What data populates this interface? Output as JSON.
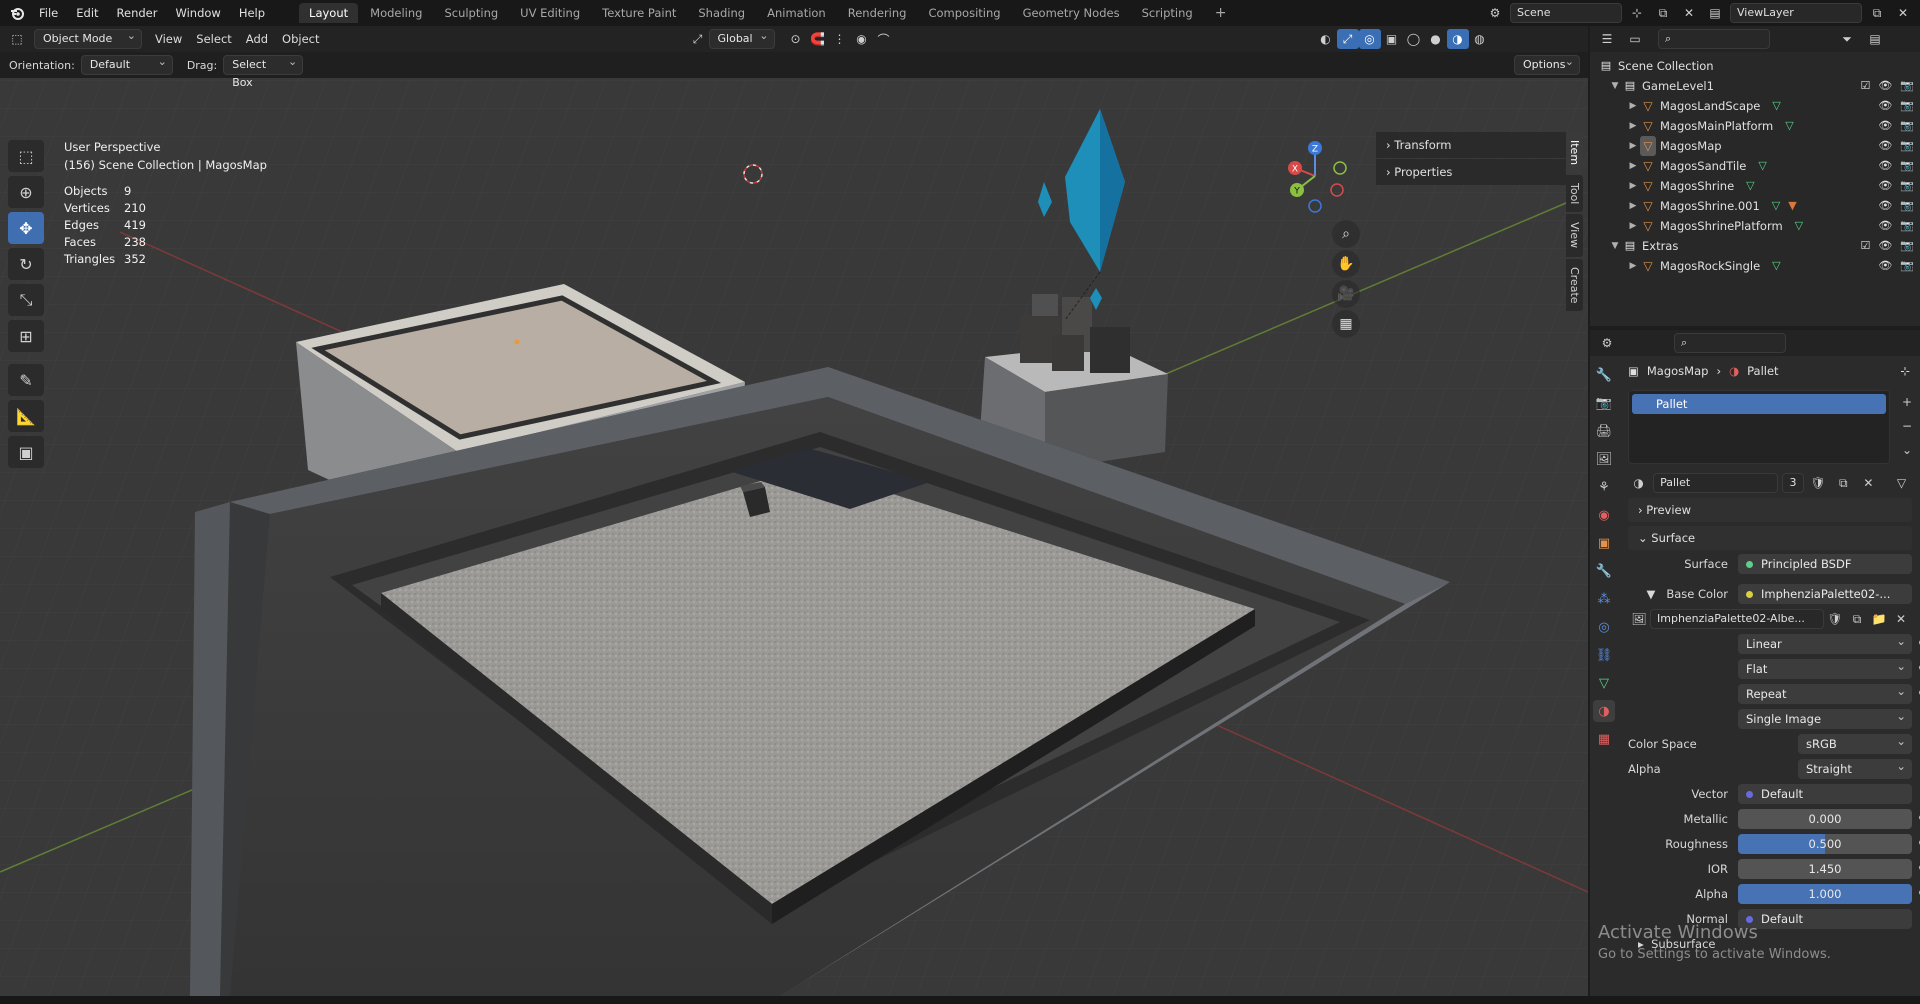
{
  "topbar": {
    "menus": [
      "File",
      "Edit",
      "Render",
      "Window",
      "Help"
    ],
    "workspaces": [
      "Layout",
      "Modeling",
      "Sculpting",
      "UV Editing",
      "Texture Paint",
      "Shading",
      "Animation",
      "Rendering",
      "Compositing",
      "Geometry Nodes",
      "Scripting"
    ],
    "active_workspace": "Layout",
    "add_tab": "+",
    "scene_name": "Scene",
    "view_layer": "ViewLayer"
  },
  "viewport_header": {
    "mode": "Object Mode",
    "menus": [
      "View",
      "Select",
      "Add",
      "Object"
    ],
    "transform_orientation": "Global",
    "orientation_label": "Orientation:",
    "orientation_value": "Default",
    "drag_label": "Drag:",
    "drag_value": "Select Box",
    "options": "Options"
  },
  "viewport_overlay": {
    "view_name": "User Perspective",
    "collection_info": "(156) Scene Collection | MagosMap",
    "stats": [
      {
        "label": "Objects",
        "value": "9"
      },
      {
        "label": "Vertices",
        "value": "210"
      },
      {
        "label": "Edges",
        "value": "419"
      },
      {
        "label": "Faces",
        "value": "238"
      },
      {
        "label": "Triangles",
        "value": "352"
      }
    ],
    "gizmo": {
      "x": "X",
      "y": "Y",
      "z": "Z"
    }
  },
  "n_panel": {
    "sections": [
      "Transform",
      "Properties"
    ],
    "tabs": [
      "Item",
      "Tool",
      "View",
      "Create"
    ],
    "active_tab": "Item"
  },
  "outliner": {
    "root": "Scene Collection",
    "rows": [
      {
        "name": "GameLevel1",
        "type": "collection",
        "depth": 0
      },
      {
        "name": "MagosLandScape",
        "type": "object",
        "depth": 1
      },
      {
        "name": "MagosMainPlatform",
        "type": "object",
        "depth": 1
      },
      {
        "name": "MagosMap",
        "type": "object",
        "depth": 1
      },
      {
        "name": "MagosSandTile",
        "type": "object",
        "depth": 1
      },
      {
        "name": "MagosShrine",
        "type": "object",
        "depth": 1
      },
      {
        "name": "MagosShrine.001",
        "type": "object",
        "depth": 1
      },
      {
        "name": "MagosShrinePlatform",
        "type": "object",
        "depth": 1
      },
      {
        "name": "Extras",
        "type": "collection",
        "depth": 0
      },
      {
        "name": "MagosRockSingle",
        "type": "object",
        "depth": 1
      }
    ]
  },
  "properties": {
    "object": "MagosMap",
    "material": "Pallet",
    "slot": "Pallet",
    "material_name": "Pallet",
    "users": "3",
    "preview_label": "Preview",
    "surface_section": "Surface",
    "surface_label": "Surface",
    "surface_value": "Principled BSDF",
    "base_color_label": "Base Color",
    "base_color_value": "ImphenziaPalette02-...",
    "image_name": "ImphenziaPalette02-Albe...",
    "interpolation": "Linear",
    "projection": "Flat",
    "extension": "Repeat",
    "source": "Single Image",
    "color_space_label": "Color Space",
    "color_space": "sRGB",
    "alpha_label": "Alpha",
    "alpha_mode": "Straight",
    "vector_label": "Vector",
    "vector_value": "Default",
    "metallic_label": "Metallic",
    "metallic": "0.000",
    "roughness_label": "Roughness",
    "roughness": "0.500",
    "ior_label": "IOR",
    "ior": "1.450",
    "alpha_value_label": "Alpha",
    "alpha_value": "1.000",
    "normal_label": "Normal",
    "normal_value": "Default",
    "subsurface_label": "Subsurface",
    "roughness_fill": 0.5,
    "alpha_fill": 1.0
  },
  "watermark": {
    "title": "Activate Windows",
    "subtitle": "Go to Settings to activate Windows."
  },
  "colors": {
    "accent": "#4772b3",
    "object_orange": "#e3924b",
    "mesh_green": "#5ad08a",
    "crystal_blue": "#1d8fb8"
  }
}
